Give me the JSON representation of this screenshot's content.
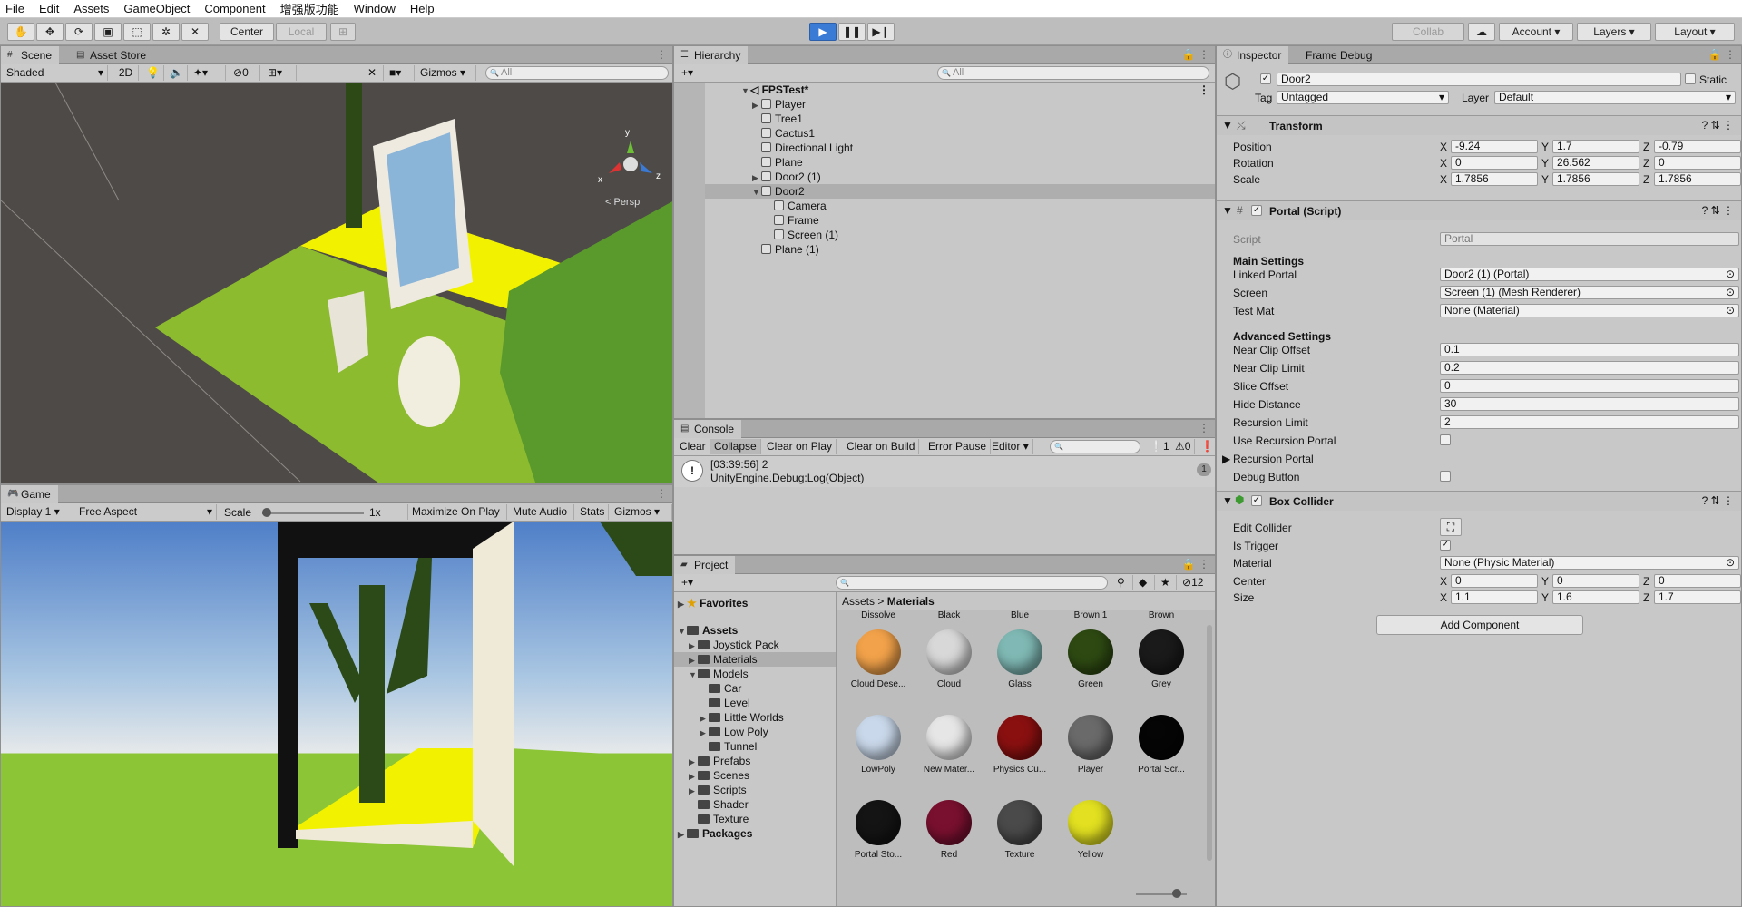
{
  "menu": [
    "File",
    "Edit",
    "Assets",
    "GameObject",
    "Component",
    "增强版功能",
    "Window",
    "Help"
  ],
  "toolbar": {
    "center": "Center",
    "local": "Local",
    "collab": "Collab",
    "account": "Account",
    "layers": "Layers",
    "layout": "Layout"
  },
  "scene": {
    "tab_scene": "Scene",
    "tab_store": "Asset Store",
    "shading": "Shaded",
    "mode_2d": "2D",
    "fx_count": "0",
    "gizmos": "Gizmos",
    "search_placeholder": "All",
    "persp": "< Persp",
    "axis_y": "y",
    "axis_x": "x",
    "axis_z": "z"
  },
  "game": {
    "tab": "Game",
    "display": "Display 1",
    "aspect": "Free Aspect",
    "scale_label": "Scale",
    "scale_value": "1x",
    "maximize": "Maximize On Play",
    "mute": "Mute Audio",
    "stats": "Stats",
    "gizmos": "Gizmos",
    "scale_fraction": 0.0
  },
  "hierarchy": {
    "tab": "Hierarchy",
    "search_placeholder": "All",
    "scene_name": "FPSTest*",
    "items": [
      {
        "label": "Player",
        "expandable": true
      },
      {
        "label": "Tree1",
        "expandable": false
      },
      {
        "label": "Cactus1",
        "expandable": false
      },
      {
        "label": "Directional Light",
        "expandable": false
      },
      {
        "label": "Plane",
        "expandable": false
      },
      {
        "label": "Door2 (1)",
        "expandable": true
      },
      {
        "label": "Door2",
        "expandable": true,
        "selected": true
      },
      {
        "label": "Camera",
        "child": true
      },
      {
        "label": "Frame",
        "child": true
      },
      {
        "label": "Screen (1)",
        "child": true
      },
      {
        "label": "Plane (1)",
        "expandable": false
      }
    ]
  },
  "console": {
    "tab": "Console",
    "buttons": [
      "Clear",
      "Collapse",
      "Clear on Play",
      "Clear on Build",
      "Error Pause",
      "Editor"
    ],
    "count_info": "1",
    "count_warn": "0",
    "count_err": "0",
    "log_line1": "[03:39:56] 2",
    "log_line2": "UnityEngine.Debug:Log(Object)",
    "log_count": "1"
  },
  "project": {
    "tab": "Project",
    "search_placeholder": "",
    "hidden_count": "12",
    "breadcrumb_root": "Assets",
    "breadcrumb_sep": ">",
    "breadcrumb_current": "Materials",
    "favorites": "Favorites",
    "assets": "Assets",
    "tree": [
      "Joystick Pack",
      "Materials",
      "Models",
      "Car",
      "Level",
      "Little Worlds",
      "Low Poly",
      "Tunnel",
      "Prefabs",
      "Scenes",
      "Scripts",
      "Shader",
      "Texture"
    ],
    "packages": "Packages",
    "header_labels": [
      "Dissolve",
      "Black",
      "Blue",
      "Brown 1",
      "Brown"
    ],
    "materials": [
      {
        "label": "Cloud Dese...",
        "color": "#f2a24a"
      },
      {
        "label": "Cloud",
        "color": "#d8d8d8"
      },
      {
        "label": "Glass",
        "color": "#7fb8b4"
      },
      {
        "label": "Green",
        "color": "#2e4a12"
      },
      {
        "label": "Grey",
        "color": "#1a1a1a"
      },
      {
        "label": "LowPoly",
        "color": "#c9d8ea"
      },
      {
        "label": "New Mater...",
        "color": "#e6e6e6"
      },
      {
        "label": "Physics Cu...",
        "color": "#8a1010"
      },
      {
        "label": "Player",
        "color": "#6a6a6a"
      },
      {
        "label": "Portal Scr...",
        "color": "#050505"
      },
      {
        "label": "Portal Sto...",
        "color": "#141414"
      },
      {
        "label": "Red",
        "color": "#7a1030"
      },
      {
        "label": "Texture",
        "color": "#4a4a4a"
      },
      {
        "label": "Yellow",
        "color": "#e2e020"
      }
    ]
  },
  "inspector": {
    "tab": "Inspector",
    "tab2": "Frame Debug",
    "object_name": "Door2",
    "static": "Static",
    "tag_label": "Tag",
    "tag_value": "Untagged",
    "layer_label": "Layer",
    "layer_value": "Default",
    "transform": {
      "title": "Transform",
      "position_label": "Position",
      "pos": [
        "-9.24",
        "1.7",
        "-0.79"
      ],
      "rotation_label": "Rotation",
      "rot": [
        "0",
        "26.562",
        "0"
      ],
      "scale_label": "Scale",
      "scl": [
        "1.7856",
        "1.7856",
        "1.7856"
      ],
      "x": "X",
      "y": "Y",
      "z": "Z"
    },
    "portal": {
      "title": "Portal (Script)",
      "script_label": "Script",
      "script_value": "Portal",
      "main_settings": "Main Settings",
      "linked_label": "Linked Portal",
      "linked_value": "Door2 (1) (Portal)",
      "screen_label": "Screen",
      "screen_value": "Screen (1) (Mesh Renderer)",
      "testmat_label": "Test Mat",
      "testmat_value": "None (Material)",
      "advanced": "Advanced Settings",
      "near_clip_offset_label": "Near Clip Offset",
      "near_clip_offset": "0.1",
      "near_clip_limit_label": "Near Clip Limit",
      "near_clip_limit": "0.2",
      "slice_offset_label": "Slice Offset",
      "slice_offset": "0",
      "hide_distance_label": "Hide Distance",
      "hide_distance": "30",
      "recursion_limit_label": "Recursion Limit",
      "recursion_limit": "2",
      "use_recursion_label": "Use Recursion Portal",
      "recursion_portal_label": "Recursion Portal",
      "debug_button_label": "Debug Button"
    },
    "box": {
      "title": "Box Collider",
      "edit_label": "Edit Collider",
      "trigger_label": "Is Trigger",
      "check": "✓",
      "material_label": "Material",
      "material_value": "None (Physic Material)",
      "center_label": "Center",
      "center": [
        "0",
        "0",
        "0"
      ],
      "size_label": "Size",
      "size": [
        "1.1",
        "1.6",
        "1.7"
      ]
    },
    "add_component": "Add Component"
  }
}
